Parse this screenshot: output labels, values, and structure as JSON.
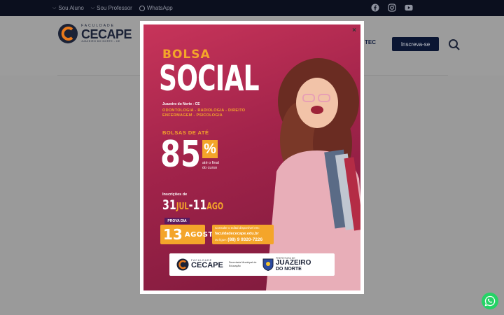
{
  "topbar": {
    "links": [
      {
        "label": "Sou Aluno"
      },
      {
        "label": "Sou Professor"
      },
      {
        "label": "WhatsApp"
      }
    ],
    "social_icons": [
      "facebook-icon",
      "instagram-icon",
      "youtube-icon"
    ]
  },
  "header": {
    "logo": {
      "top": "FACULDADE",
      "name": "CECAPE",
      "sub": "JUAZEIRO DO NORTE - CE"
    },
    "nav_partial": "TEC",
    "cta_label": "Inscreva-se",
    "search_icon": "search-icon"
  },
  "popup": {
    "close_label": "×",
    "poster": {
      "bolsa": "BOLSA",
      "social": "SOCIAL",
      "city": "Juazeiro do Norte - CE",
      "courses_line1": "ODONTOLOGIA - RADIOLOGIA - DIREITO",
      "courses_line2": "ENFERMAGEM - PSICOLOGIA",
      "bolsas_ate": "BOLSAS DE ATÉ",
      "percent_value": "85",
      "percent_sign": "%",
      "ate_final_1": "até o final",
      "ate_final_2": "do curso",
      "inscricoes_label": "Inscrições de",
      "date_start_day": "31",
      "date_start_month": "JUL",
      "date_sep": "-",
      "date_end_day": "11",
      "date_end_month": "AGO",
      "prova_tag": "PROVA DIA",
      "prova_day": "13",
      "prova_month": "AGOSTO",
      "info_line1": "Consulte o edital disponível em:",
      "info_site": "faculdadececape.edu.br",
      "info_ligue": "ou ligue:",
      "info_phone": "(88) 9 9320-7226",
      "footer_logo_top": "FACULDADE",
      "footer_logo_name": "CECAPE",
      "footer_secretaria": "Secretaria Municipal de Educação",
      "footer_pref_small": "PREFEITURA DE",
      "footer_pref_big": "JUAZEIRO",
      "footer_pref_sub": "DO NORTE"
    }
  },
  "colors": {
    "accent": "#f4a52a",
    "poster_bg": "#a1234a",
    "cta_bg": "#0b1633",
    "whatsapp": "#25d366"
  }
}
